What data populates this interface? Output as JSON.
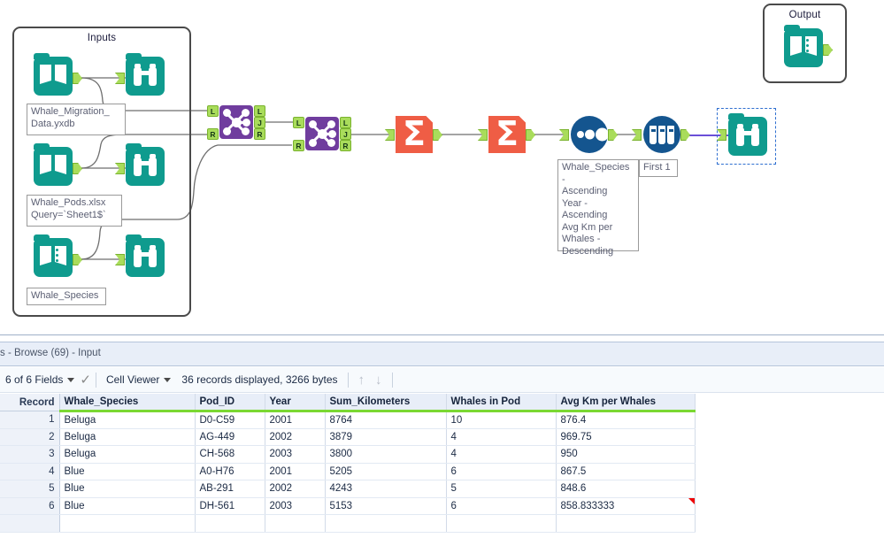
{
  "canvas": {
    "containers": [
      {
        "id": "inputs",
        "title": "Inputs"
      },
      {
        "id": "output",
        "title": "Output"
      }
    ],
    "annotations": [
      {
        "id": "anno-migration",
        "text": "Whale_Migration_\nData.yxdb"
      },
      {
        "id": "anno-pods",
        "text": "Whale_Pods.xlsx\nQuery=`Sheet1$`"
      },
      {
        "id": "anno-species",
        "text": "Whale_Species"
      },
      {
        "id": "anno-sort",
        "text": "Whale_Species -\nAscending\nYear - Ascending\nAvg Km per\nWhales -\nDescending"
      },
      {
        "id": "anno-sample",
        "text": "First 1"
      }
    ],
    "join_ports": {
      "left": "L",
      "join": "J",
      "right": "R"
    },
    "sigma_glyph": "Σ",
    "tools": [
      {
        "name": "input-data-tool-migration",
        "type": "input-data-icon"
      },
      {
        "name": "browse-tool-migration",
        "type": "browse-icon"
      },
      {
        "name": "input-data-tool-pods",
        "type": "input-data-icon"
      },
      {
        "name": "browse-tool-pods",
        "type": "browse-icon"
      },
      {
        "name": "input-data-tool-species",
        "type": "input-data-icon"
      },
      {
        "name": "browse-tool-species",
        "type": "browse-icon"
      },
      {
        "name": "join-tool-1",
        "type": "join-icon"
      },
      {
        "name": "join-tool-2",
        "type": "join-icon"
      },
      {
        "name": "summarize-tool-1",
        "type": "summarize-icon"
      },
      {
        "name": "summarize-tool-2",
        "type": "summarize-icon"
      },
      {
        "name": "sort-tool",
        "type": "sort-icon"
      },
      {
        "name": "sample-tool",
        "type": "sample-icon"
      },
      {
        "name": "browse-tool-output",
        "type": "browse-icon"
      },
      {
        "name": "output-data-tool",
        "type": "input-data-icon"
      }
    ],
    "colors": {
      "input_teal": "#0f9b8e",
      "join_purple": "#703d9e",
      "summarize_red": "#ef5d45",
      "sort_blue": "#14558f",
      "connector_green": "#a9dc5b",
      "wire_gray": "#6e6e6e",
      "selected_wire": "#6b4fd8",
      "selection_border": "#2f6fd0"
    }
  },
  "results": {
    "tab_title": "s - Browse (69) - Input",
    "toolbar": {
      "fields_label": "6 of 6 Fields",
      "view_label": "Cell Viewer",
      "records_label": "36 records displayed, 3266 bytes",
      "check_glyph": "✓",
      "up_arrow": "↑",
      "down_arrow": "↓"
    },
    "grid": {
      "record_header": "Record",
      "columns": [
        "Whale_Species",
        "Pod_ID",
        "Year",
        "Sum_Kilometers",
        "Whales in Pod",
        "Avg Km per Whales"
      ],
      "rows": [
        {
          "record": "1",
          "cells": [
            "Beluga",
            "D0-C59",
            "2001",
            "8764",
            "10",
            "876.4"
          ]
        },
        {
          "record": "2",
          "cells": [
            "Beluga",
            "AG-449",
            "2002",
            "3879",
            "4",
            "969.75"
          ]
        },
        {
          "record": "3",
          "cells": [
            "Beluga",
            "CH-568",
            "2003",
            "3800",
            "4",
            "950"
          ]
        },
        {
          "record": "4",
          "cells": [
            "Blue",
            "A0-H76",
            "2001",
            "5205",
            "6",
            "867.5"
          ]
        },
        {
          "record": "5",
          "cells": [
            "Blue",
            "AB-291",
            "2002",
            "4243",
            "5",
            "848.6"
          ]
        },
        {
          "record": "6",
          "cells": [
            "Blue",
            "DH-561",
            "2003",
            "5153",
            "6",
            "858.833333"
          ]
        }
      ]
    }
  }
}
